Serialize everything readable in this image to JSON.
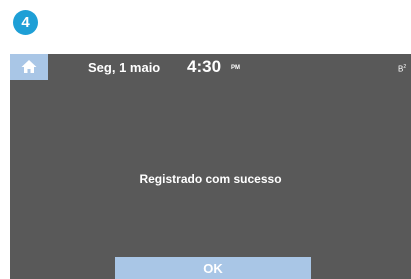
{
  "step": {
    "number": "4"
  },
  "status_bar": {
    "home_icon": "home-icon",
    "date": "Seg, 1 maio",
    "time": "4:30",
    "ampm": "PM",
    "indicator": "B",
    "indicator_sup": "2"
  },
  "dialog": {
    "message": "Registrado com sucesso",
    "ok_label": "OK"
  },
  "colors": {
    "badge": "#1e9fd6",
    "screen_bg": "#595959",
    "button_bg": "#a9c6e6",
    "text": "#ffffff"
  }
}
